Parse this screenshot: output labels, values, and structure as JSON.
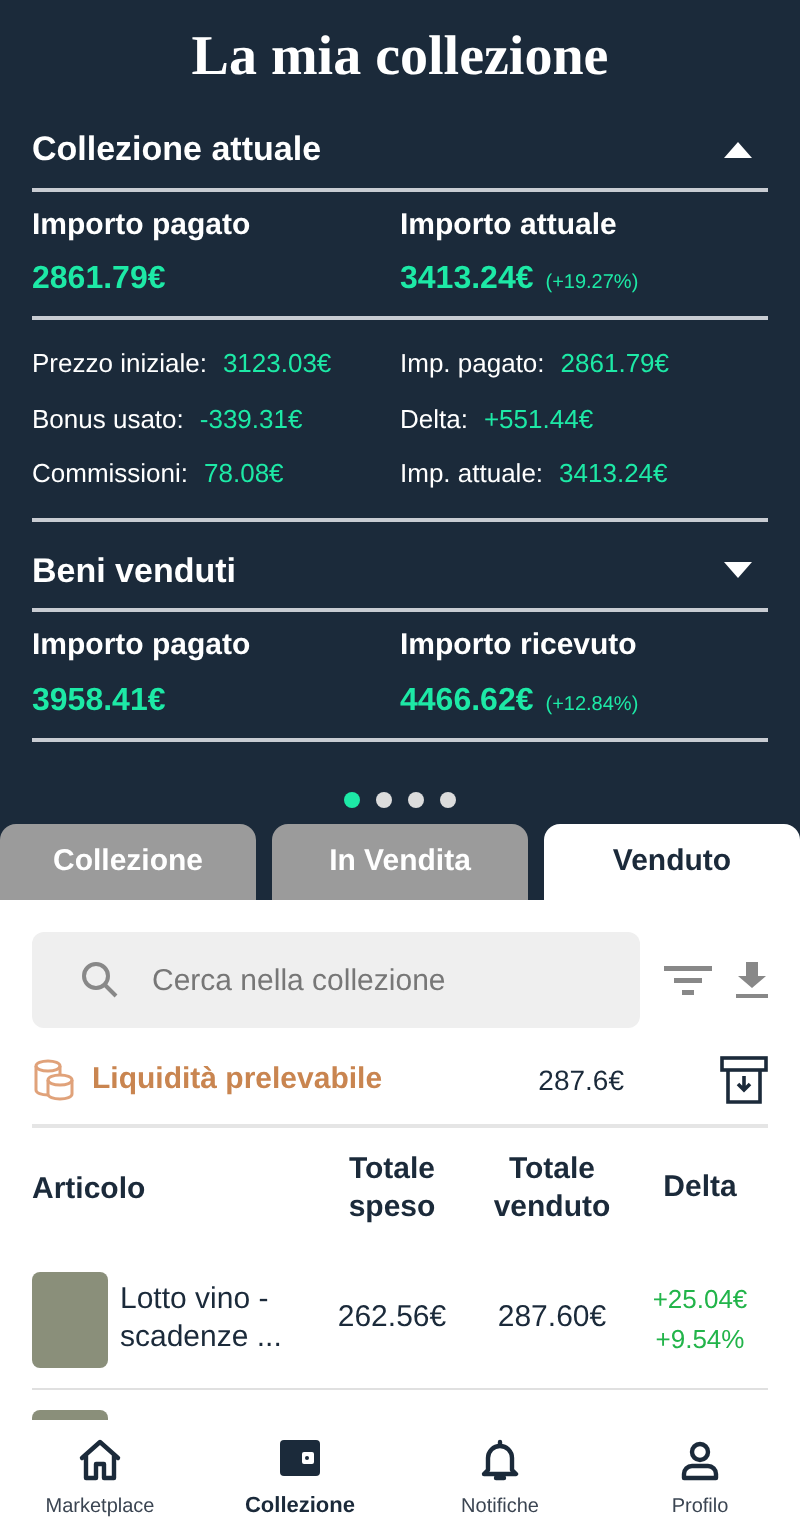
{
  "title": "La mia collezione",
  "sections": [
    {
      "title": "Collezione attuale",
      "expanded": true,
      "summary": [
        {
          "label": "Importo pagato",
          "value": "2861.79€"
        },
        {
          "label": "Importo attuale",
          "value": "3413.24€",
          "change": "(+19.27%)"
        }
      ],
      "details": [
        {
          "label": "Prezzo iniziale:",
          "value": "3123.03€"
        },
        {
          "label": "Imp. pagato:",
          "value": "2861.79€"
        },
        {
          "label": "Bonus usato:",
          "value": "-339.31€"
        },
        {
          "label": "Delta:",
          "value": "+551.44€"
        },
        {
          "label": "Commissioni:",
          "value": "78.08€"
        },
        {
          "label": "Imp. attuale:",
          "value": "3413.24€"
        }
      ]
    },
    {
      "title": "Beni venduti",
      "expanded": false,
      "summary": [
        {
          "label": "Importo pagato",
          "value": "3958.41€"
        },
        {
          "label": "Importo ricevuto",
          "value": "4466.62€",
          "change": "(+12.84%)"
        }
      ]
    }
  ],
  "pager": [
    {
      "selected": true
    },
    {
      "selected": false
    },
    {
      "selected": false
    },
    {
      "selected": false
    }
  ],
  "tabs": [
    {
      "label": "Collezione",
      "selected": false
    },
    {
      "label": "In Vendita",
      "selected": false
    },
    {
      "label": "Venduto",
      "selected": true
    }
  ],
  "search": {
    "placeholder": "Cerca nella collezione"
  },
  "liquidity": {
    "label": "Liquidità prelevabile",
    "value": "287.6€"
  },
  "table": {
    "columns": [
      "Articolo",
      "Totale speso",
      "Totale venduto",
      "Delta"
    ],
    "rows": [
      {
        "name": "Lotto vino - scadenze ...",
        "spent": "262.56€",
        "sold": "287.60€",
        "delta": "+25.04€",
        "delta_pct": "+9.54%"
      },
      {}
    ]
  },
  "nav": [
    {
      "label": "Marketplace",
      "selected": false,
      "kind": "home"
    },
    {
      "label": "Collezione",
      "selected": true,
      "kind": "wallet"
    },
    {
      "label": "Notifiche",
      "selected": false,
      "kind": "bell"
    },
    {
      "label": "Profilo",
      "selected": false,
      "kind": "user"
    }
  ]
}
